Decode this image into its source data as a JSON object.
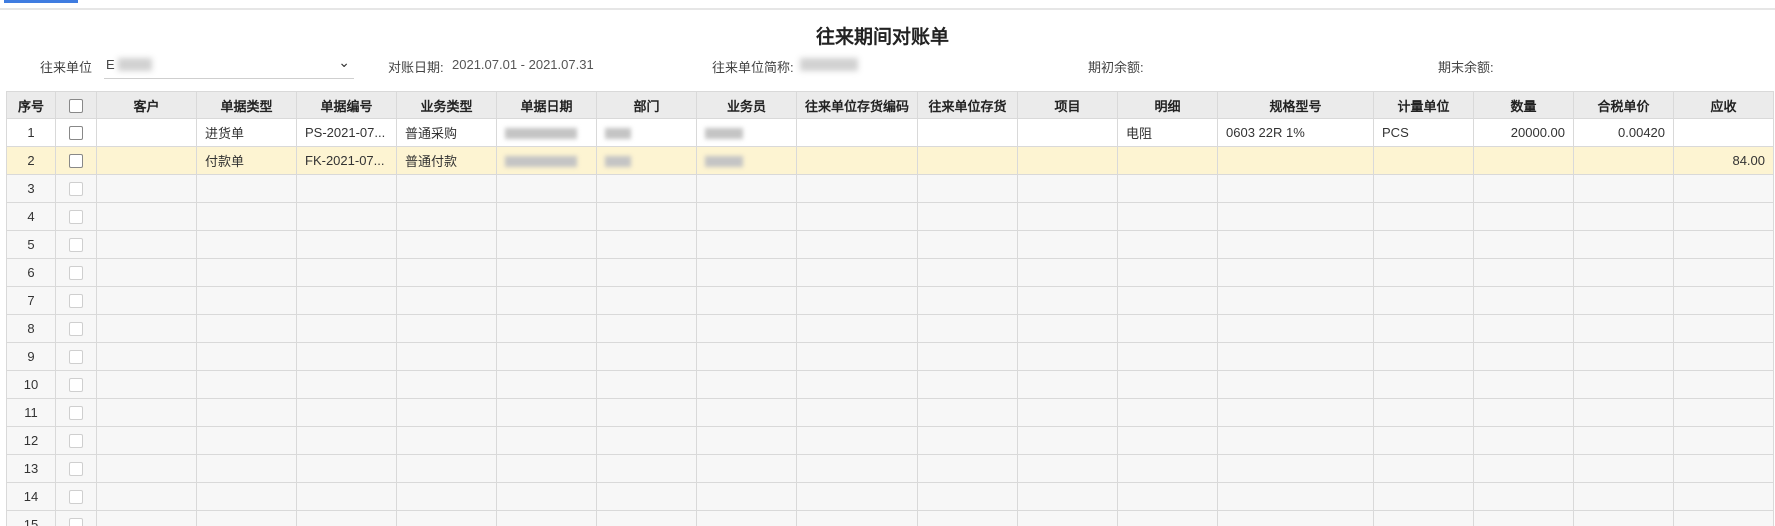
{
  "page": {
    "title": "往来期间对账单"
  },
  "filters": {
    "partner_label": "往来单位",
    "partner_value": "E",
    "date_label": "对账日期:",
    "date_value": "2021.07.01 - 2021.07.31",
    "short_name_label": "往来单位简称:",
    "opening_label": "期初余额:",
    "closing_label": "期末余额:"
  },
  "table": {
    "columns": [
      "序号",
      "",
      "客户",
      "单据类型",
      "单据编号",
      "业务类型",
      "单据日期",
      "部门",
      "业务员",
      "往来单位存货编码",
      "往来单位存货",
      "项目",
      "明细",
      "规格型号",
      "计量单位",
      "数量",
      "合税单价",
      "应收"
    ],
    "rows": [
      {
        "no": "1",
        "customer": "",
        "doc_type": "进货单",
        "doc_no": "PS-2021-07...",
        "biz_type": "普通采购",
        "item": "",
        "detail": "电阻",
        "spec": "0603 22R 1%",
        "unit": "PCS",
        "qty": "20000.00",
        "price": "0.00420",
        "receivable": ""
      },
      {
        "no": "2",
        "customer": "",
        "doc_type": "付款单",
        "doc_no": "FK-2021-07...",
        "biz_type": "普通付款",
        "item": "",
        "detail": "",
        "spec": "",
        "unit": "",
        "qty": "",
        "price": "",
        "receivable": "84.00"
      }
    ],
    "empty_rows": [
      "3",
      "4",
      "5",
      "6",
      "7",
      "8",
      "9",
      "10",
      "11",
      "12",
      "13",
      "14",
      "15"
    ],
    "selected_row": "2"
  },
  "icons": {
    "dropdown": "chevron-down-icon",
    "checkbox": "checkbox-icon"
  },
  "colors": {
    "header_bg": "#ebebeb",
    "selected_row_bg": "#fdf4d2",
    "link": "#2a3fbf",
    "accent_tab": "#3f7ce0"
  }
}
